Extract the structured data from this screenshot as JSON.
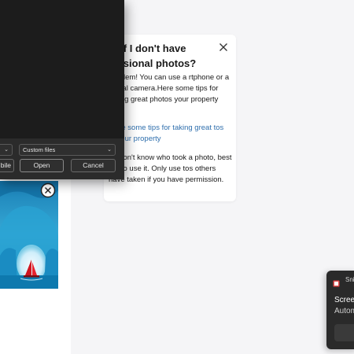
{
  "help_card": {
    "title": "at if I don't have fessional photos?",
    "body": "problem! You can use a rtphone or a digital camera.Here some tips for taking great photos your property",
    "link": "e are some tips for taking great tos of your property",
    "note": "ou don't know who took a photo, best not to use it. Only use tos others have taken if you have permission.",
    "close_icon": "close-icon"
  },
  "file_dialog": {
    "file_type_value": "Custom files",
    "mobile_button": "bile",
    "open_button": "Open",
    "cancel_button": "Cancel",
    "chevron_icon": "chevron-down-icon"
  },
  "photo": {
    "description_icon": "photo-thumbnail",
    "remove_icon": "remove-circle-icon"
  },
  "toast": {
    "app_name": "Sni",
    "title": "Screen",
    "subtitle": "Autom"
  },
  "colors": {
    "dialog_bg": "#1c1c1c",
    "link": "#2f6fad",
    "page_bg": "#f5f5f7",
    "toast_bg": "#2a2a2a"
  }
}
